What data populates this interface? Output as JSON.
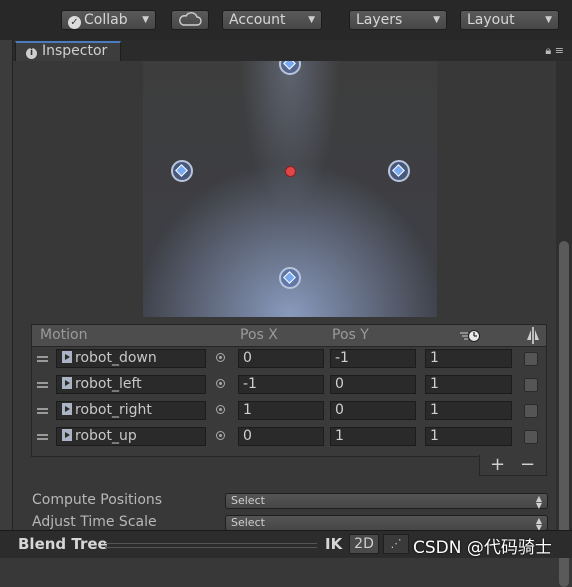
{
  "toolbar": {
    "collab_label": "Collab",
    "account_label": "Account",
    "layers_label": "Layers",
    "layout_label": "Layout"
  },
  "inspector": {
    "tab_label": "Inspector"
  },
  "motion_table": {
    "headers": {
      "motion": "Motion",
      "pos_x": "Pos X",
      "pos_y": "Pos Y"
    },
    "rows": [
      {
        "motion": "robot_down",
        "pos_x": "0",
        "pos_y": "-1",
        "threshold": "1"
      },
      {
        "motion": "robot_left",
        "pos_x": "-1",
        "pos_y": "0",
        "threshold": "1"
      },
      {
        "motion": "robot_right",
        "pos_x": "1",
        "pos_y": "0",
        "threshold": "1"
      },
      {
        "motion": "robot_up",
        "pos_x": "0",
        "pos_y": "1",
        "threshold": "1"
      }
    ]
  },
  "settings": {
    "compute_positions_label": "Compute Positions",
    "compute_positions_value": "Select",
    "adjust_time_scale_label": "Adjust Time Scale",
    "adjust_time_scale_value": "Select"
  },
  "bottom_bar": {
    "title": "Blend Tree",
    "ik_label": "IK",
    "mode_label": "2D",
    "watermark": "CSDN @代码骑士"
  },
  "colors": {
    "accent_blue": "#78a8ee",
    "center_dot": "#e04848",
    "tab_highlight": "#4a7bbf"
  }
}
